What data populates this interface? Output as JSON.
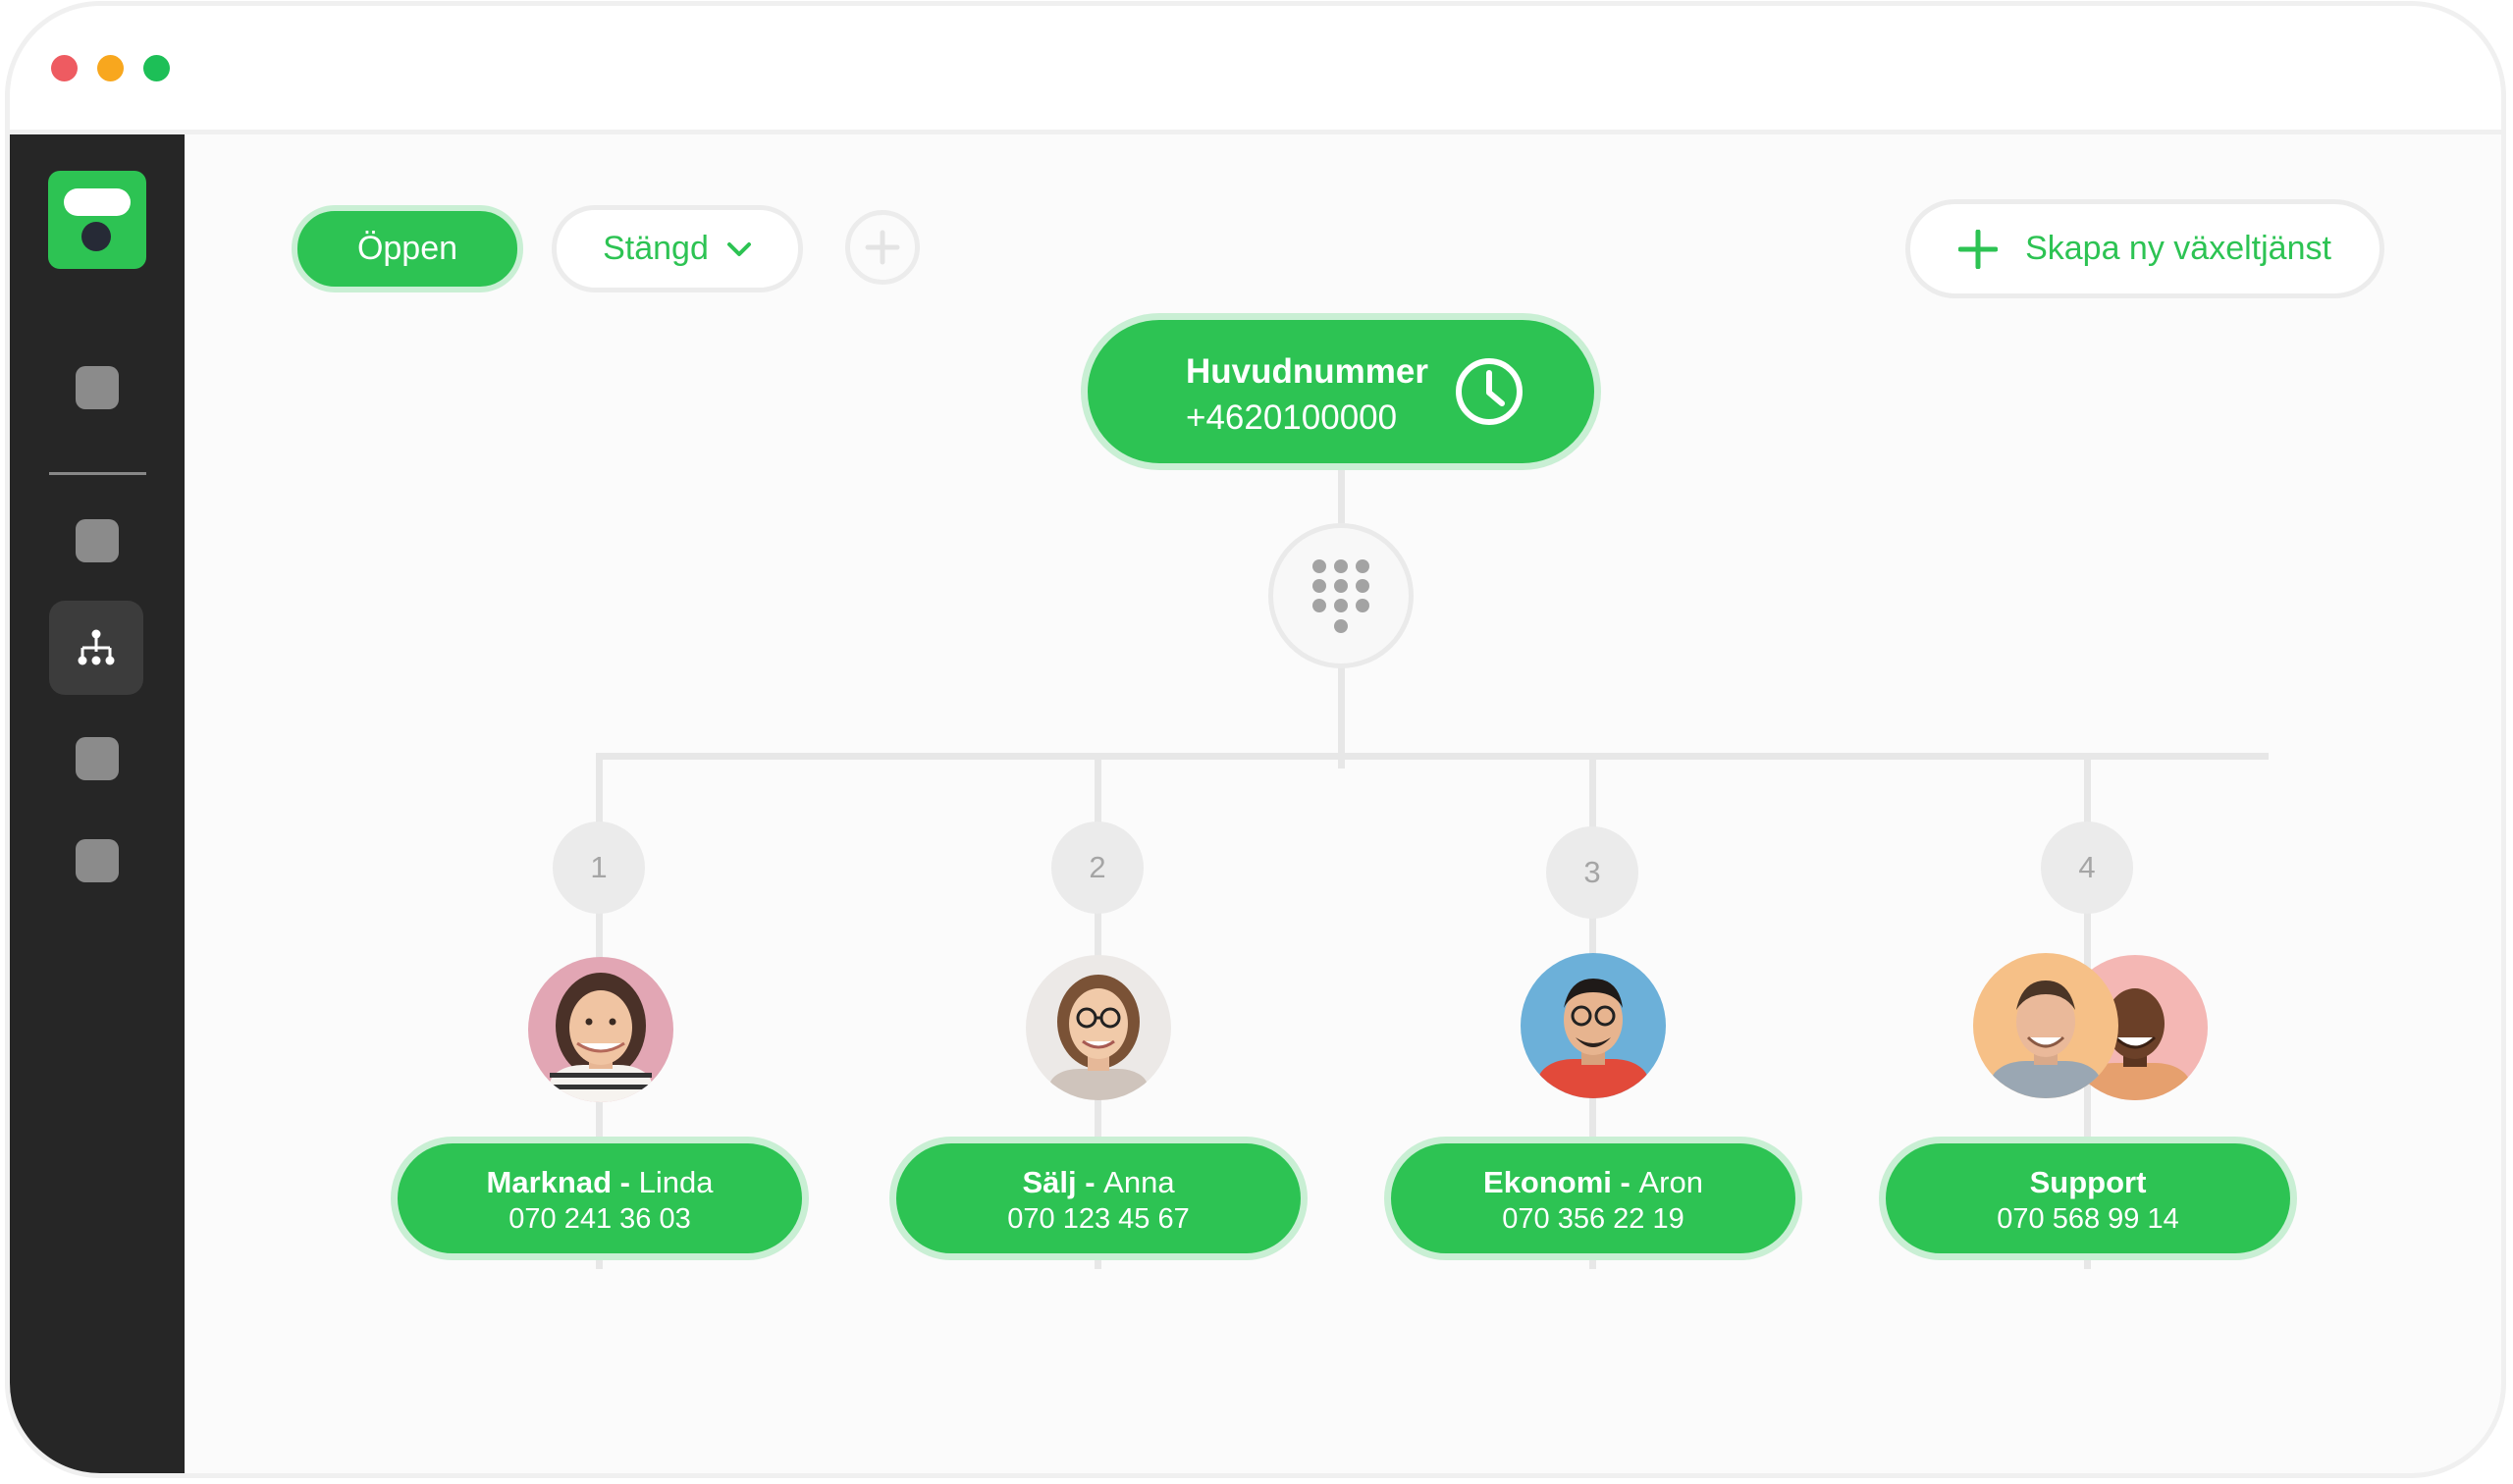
{
  "window": {
    "traffic_lights": [
      "#ee5b61",
      "#f8a71e",
      "#1dbf57"
    ]
  },
  "sidebar": {
    "logo_icon": "app-logo",
    "active_item_icon": "org-chart-icon"
  },
  "toolbar": {
    "open_label": "Öppen",
    "closed_label": "Stängd",
    "add_icon": "plus-circle-icon",
    "new_service_label": "Skapa ny växeltjänst"
  },
  "main_number": {
    "label": "Huvudnummer",
    "number": "+4620100000",
    "icon": "clock-icon"
  },
  "keypad": {
    "icon": "dialpad-icon"
  },
  "branches": [
    {
      "option": "1",
      "name": "Marknad",
      "separator": " - ",
      "person": "Linda",
      "phone": "070 241 36 03"
    },
    {
      "option": "2",
      "name": "Sälj",
      "separator": " - ",
      "person": "Anna",
      "phone": "070 123 45 67"
    },
    {
      "option": "3",
      "name": "Ekonomi",
      "separator": " - ",
      "person": "Aron",
      "phone": "070 356 22 19"
    },
    {
      "option": "4",
      "name": "Support",
      "separator": "",
      "person": "",
      "phone": "070 568 99 14"
    }
  ],
  "colors": {
    "accent": "#2dc353",
    "accent_light": "#c9efd4",
    "sidebar": "#262626"
  }
}
